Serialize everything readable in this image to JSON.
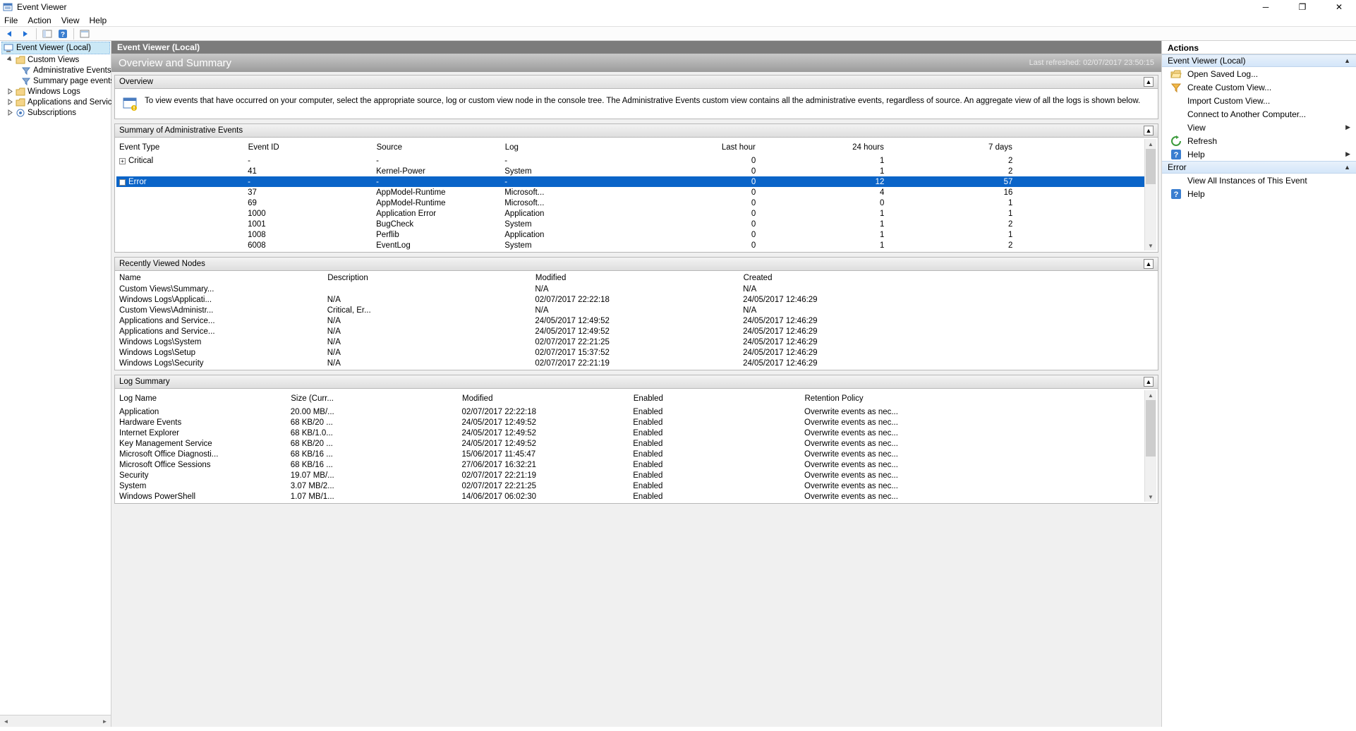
{
  "window": {
    "title": "Event Viewer"
  },
  "menus": {
    "file": "File",
    "action": "Action",
    "view": "View",
    "help": "Help"
  },
  "tree": {
    "root": "Event Viewer (Local)",
    "items": [
      {
        "label": "Custom Views",
        "expanded": true,
        "children": [
          "Administrative Events",
          "Summary page events"
        ]
      },
      {
        "label": "Windows Logs",
        "expanded": false
      },
      {
        "label": "Applications and Services Lo",
        "expanded": false
      },
      {
        "label": "Subscriptions",
        "expanded": false
      }
    ]
  },
  "center": {
    "header": "Event Viewer (Local)",
    "title": "Overview and Summary",
    "refreshed": "Last refreshed: 02/07/2017 23:50:15",
    "overview": {
      "heading": "Overview",
      "text": "To view events that have occurred on your computer, select the appropriate source, log or custom view node in the console tree. The Administrative Events custom view contains all the administrative events, regardless of source. An aggregate view of all the logs is shown below."
    },
    "summary": {
      "heading": "Summary of Administrative Events",
      "cols": [
        "Event Type",
        "Event ID",
        "Source",
        "Log",
        "Last hour",
        "24 hours",
        "7 days"
      ],
      "rows": [
        {
          "type": "Critical",
          "expander": "+",
          "id": "-",
          "src": "-",
          "log": "-",
          "h": "0",
          "d": "1",
          "w": "2"
        },
        {
          "type": "",
          "id": "41",
          "src": "Kernel-Power",
          "log": "System",
          "h": "0",
          "d": "1",
          "w": "2"
        },
        {
          "type": "Error",
          "expander": "−",
          "selected": true,
          "id": "-",
          "src": "-",
          "log": "-",
          "h": "0",
          "d": "12",
          "w": "57"
        },
        {
          "type": "",
          "id": "37",
          "src": "AppModel-Runtime",
          "log": "Microsoft...",
          "h": "0",
          "d": "4",
          "w": "16"
        },
        {
          "type": "",
          "id": "69",
          "src": "AppModel-Runtime",
          "log": "Microsoft...",
          "h": "0",
          "d": "0",
          "w": "1"
        },
        {
          "type": "",
          "id": "1000",
          "src": "Application Error",
          "log": "Application",
          "h": "0",
          "d": "1",
          "w": "1"
        },
        {
          "type": "",
          "id": "1001",
          "src": "BugCheck",
          "log": "System",
          "h": "0",
          "d": "1",
          "w": "2"
        },
        {
          "type": "",
          "id": "1008",
          "src": "Perflib",
          "log": "Application",
          "h": "0",
          "d": "1",
          "w": "1"
        },
        {
          "type": "",
          "id": "6008",
          "src": "EventLog",
          "log": "System",
          "h": "0",
          "d": "1",
          "w": "2"
        }
      ]
    },
    "recent": {
      "heading": "Recently Viewed Nodes",
      "cols": [
        "Name",
        "Description",
        "Modified",
        "Created"
      ],
      "rows": [
        {
          "name": "Custom Views\\Summary...",
          "desc": "",
          "mod": "N/A",
          "cre": "N/A"
        },
        {
          "name": "Windows Logs\\Applicati...",
          "desc": "N/A",
          "mod": "02/07/2017 22:22:18",
          "cre": "24/05/2017 12:46:29"
        },
        {
          "name": "Custom Views\\Administr...",
          "desc": "Critical, Er...",
          "mod": "N/A",
          "cre": "N/A"
        },
        {
          "name": "Applications and Service...",
          "desc": "N/A",
          "mod": "24/05/2017 12:49:52",
          "cre": "24/05/2017 12:46:29"
        },
        {
          "name": "Applications and Service...",
          "desc": "N/A",
          "mod": "24/05/2017 12:49:52",
          "cre": "24/05/2017 12:46:29"
        },
        {
          "name": "Windows Logs\\System",
          "desc": "N/A",
          "mod": "02/07/2017 22:21:25",
          "cre": "24/05/2017 12:46:29"
        },
        {
          "name": "Windows Logs\\Setup",
          "desc": "N/A",
          "mod": "02/07/2017 15:37:52",
          "cre": "24/05/2017 12:46:29"
        },
        {
          "name": "Windows Logs\\Security",
          "desc": "N/A",
          "mod": "02/07/2017 22:21:19",
          "cre": "24/05/2017 12:46:29"
        }
      ]
    },
    "logsum": {
      "heading": "Log Summary",
      "cols": [
        "Log Name",
        "Size (Curr...",
        "Modified",
        "Enabled",
        "Retention Policy"
      ],
      "rows": [
        {
          "n": "Application",
          "s": "20.00 MB/...",
          "m": "02/07/2017 22:22:18",
          "e": "Enabled",
          "r": "Overwrite events as nec..."
        },
        {
          "n": "Hardware Events",
          "s": "68 KB/20 ...",
          "m": "24/05/2017 12:49:52",
          "e": "Enabled",
          "r": "Overwrite events as nec..."
        },
        {
          "n": "Internet Explorer",
          "s": "68 KB/1.0...",
          "m": "24/05/2017 12:49:52",
          "e": "Enabled",
          "r": "Overwrite events as nec..."
        },
        {
          "n": "Key Management Service",
          "s": "68 KB/20 ...",
          "m": "24/05/2017 12:49:52",
          "e": "Enabled",
          "r": "Overwrite events as nec..."
        },
        {
          "n": "Microsoft Office Diagnosti...",
          "s": "68 KB/16 ...",
          "m": "15/06/2017 11:45:47",
          "e": "Enabled",
          "r": "Overwrite events as nec..."
        },
        {
          "n": "Microsoft Office Sessions",
          "s": "68 KB/16 ...",
          "m": "27/06/2017 16:32:21",
          "e": "Enabled",
          "r": "Overwrite events as nec..."
        },
        {
          "n": "Security",
          "s": "19.07 MB/...",
          "m": "02/07/2017 22:21:19",
          "e": "Enabled",
          "r": "Overwrite events as nec..."
        },
        {
          "n": "System",
          "s": "3.07 MB/2...",
          "m": "02/07/2017 22:21:25",
          "e": "Enabled",
          "r": "Overwrite events as nec..."
        },
        {
          "n": "Windows PowerShell",
          "s": "1.07 MB/1...",
          "m": "14/06/2017 06:02:30",
          "e": "Enabled",
          "r": "Overwrite events as nec..."
        }
      ]
    }
  },
  "actions": {
    "title": "Actions",
    "section1": "Event Viewer (Local)",
    "items1": [
      {
        "icon": "folder-open",
        "label": "Open Saved Log..."
      },
      {
        "icon": "filter",
        "label": "Create Custom View..."
      },
      {
        "icon": "blank",
        "label": "Import Custom View..."
      },
      {
        "icon": "blank",
        "label": "Connect to Another Computer..."
      },
      {
        "icon": "blank",
        "label": "View",
        "sub": true
      },
      {
        "icon": "refresh",
        "label": "Refresh"
      },
      {
        "icon": "help",
        "label": "Help",
        "sub": true
      }
    ],
    "section2": "Error",
    "items2": [
      {
        "icon": "blank",
        "label": "View All Instances of This Event"
      },
      {
        "icon": "help",
        "label": "Help"
      }
    ]
  }
}
